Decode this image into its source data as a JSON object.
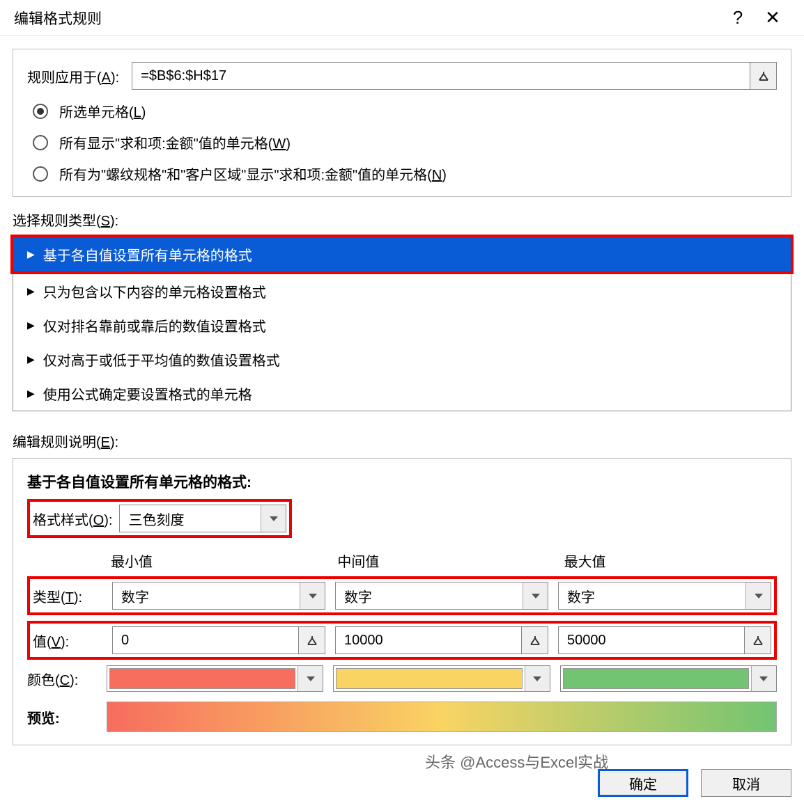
{
  "dialog": {
    "title": "编辑格式规则",
    "apply_label": "规则应用于(A):",
    "apply_value": "=$B$6:$H$17",
    "radios": [
      "所选单元格(L)",
      "所有显示\"求和项:金额\"值的单元格(W)",
      "所有为\"螺纹规格\"和\"客户区域\"显示\"求和项:金额\"值的单元格(N)"
    ],
    "rule_type_label": "选择规则类型(S):",
    "rule_types": [
      "基于各自值设置所有单元格的格式",
      "只为包含以下内容的单元格设置格式",
      "仅对排名靠前或靠后的数值设置格式",
      "仅对高于或低于平均值的数值设置格式",
      "使用公式确定要设置格式的单元格"
    ],
    "edit_desc_label": "编辑规则说明(E):",
    "format_heading": "基于各自值设置所有单元格的格式:",
    "style_label": "格式样式(O):",
    "style_value": "三色刻度",
    "columns": {
      "min_label": "最小值",
      "mid_label": "中间值",
      "max_label": "最大值"
    },
    "type_label": "类型(T):",
    "types": {
      "min": "数字",
      "mid": "数字",
      "max": "数字"
    },
    "value_label": "值(V):",
    "values": {
      "min": "0",
      "mid": "10000",
      "max": "50000"
    },
    "color_label": "颜色(C):",
    "colors": {
      "min": "#f76d5e",
      "mid": "#f9d463",
      "max": "#72c472"
    },
    "preview_label": "预览:",
    "ok": "确定",
    "cancel": "取消"
  },
  "watermark": "头条 @Access与Excel实战"
}
